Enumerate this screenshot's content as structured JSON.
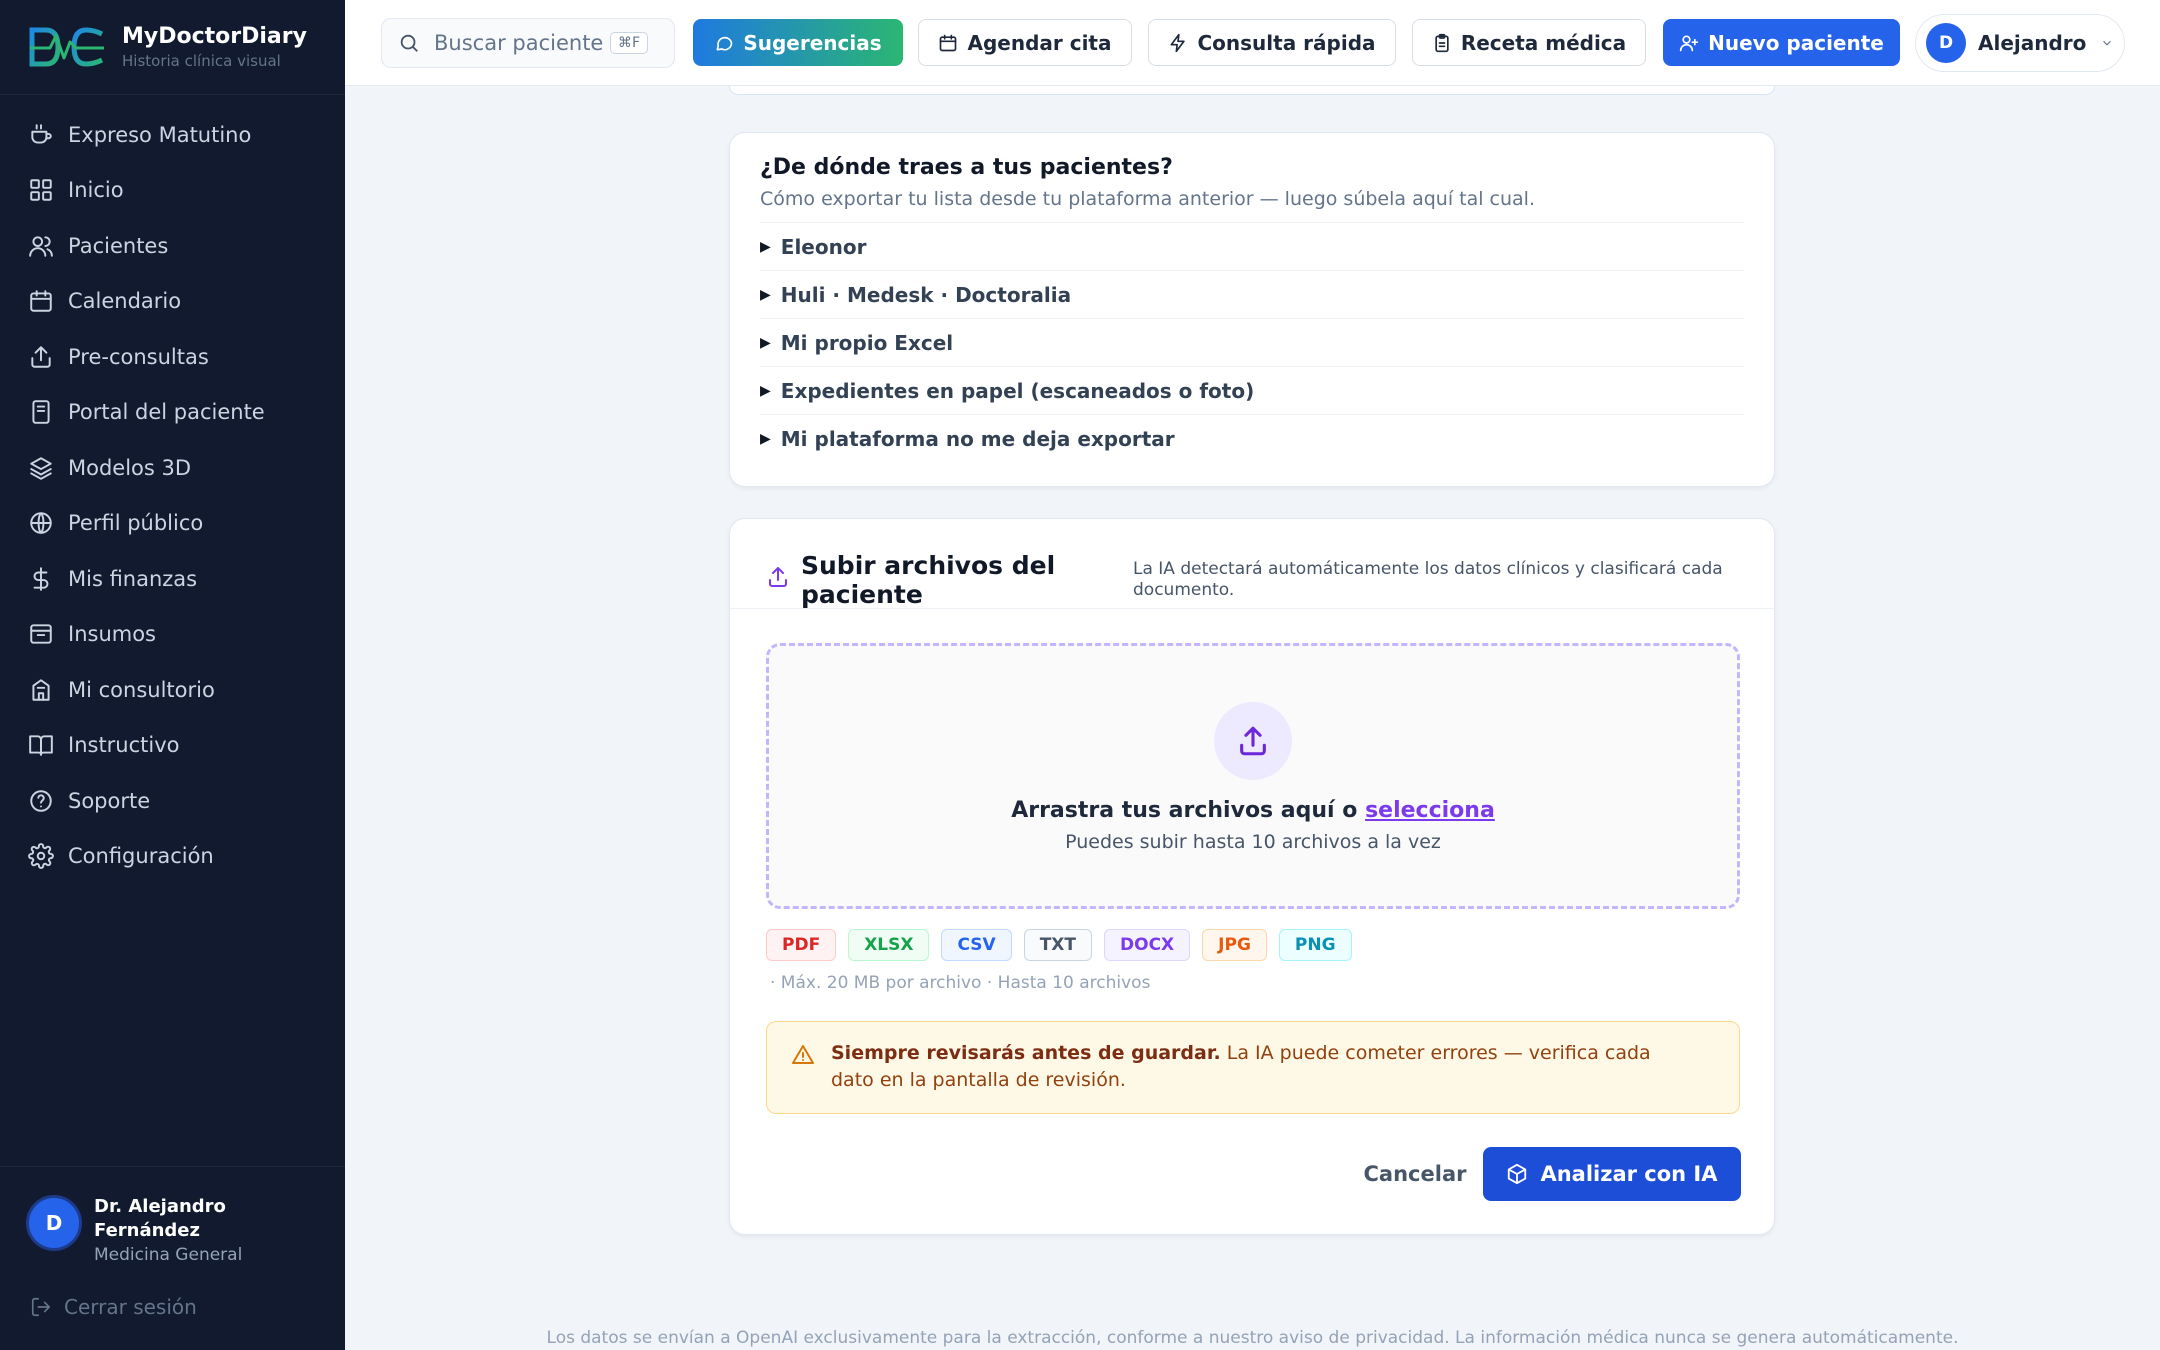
{
  "brand": {
    "name": "MyDoctorDiary",
    "tagline": "Historia clínica visual"
  },
  "sidebar": {
    "items": [
      {
        "label": "Expreso Matutino",
        "icon": "coffee-icon"
      },
      {
        "label": "Inicio",
        "icon": "grid-icon"
      },
      {
        "label": "Pacientes",
        "icon": "users-icon"
      },
      {
        "label": "Calendario",
        "icon": "calendar-icon"
      },
      {
        "label": "Pre-consultas",
        "icon": "share-icon"
      },
      {
        "label": "Portal del paciente",
        "icon": "tablet-icon"
      },
      {
        "label": "Modelos 3D",
        "icon": "layers-icon"
      },
      {
        "label": "Perfil público",
        "icon": "globe-icon"
      },
      {
        "label": "Mis finanzas",
        "icon": "dollar-icon"
      },
      {
        "label": "Insumos",
        "icon": "archive-icon"
      },
      {
        "label": "Mi consultorio",
        "icon": "building-icon"
      },
      {
        "label": "Instructivo",
        "icon": "book-icon"
      },
      {
        "label": "Soporte",
        "icon": "help-circle-icon"
      },
      {
        "label": "Configuración",
        "icon": "gear-icon"
      }
    ],
    "user": {
      "initial": "D",
      "name": "Dr. Alejandro Fernández",
      "role": "Medicina General"
    },
    "logout_label": "Cerrar sesión"
  },
  "topbar": {
    "search_placeholder": "Buscar paciente",
    "search_shortcut": "⌘F",
    "buttons": {
      "suggestions": "Sugerencias",
      "schedule": "Agendar cita",
      "quick": "Consulta rápida",
      "prescription": "Receta médica",
      "new_patient": "Nuevo paciente"
    },
    "user": {
      "initial": "D",
      "name": "Alejandro"
    }
  },
  "import_sources": {
    "title": "¿De dónde traes a tus pacientes?",
    "description": "Cómo exportar tu lista desde tu plataforma anterior — luego súbela aquí tal cual.",
    "items": [
      "Eleonor",
      "Huli · Medesk · Doctoralia",
      "Mi propio Excel",
      "Expedientes en papel (escaneados o foto)",
      "Mi plataforma no me deja exportar"
    ]
  },
  "upload": {
    "title": "Subir archivos del paciente",
    "note": "La IA detectará automáticamente los datos clínicos y clasificará cada documento.",
    "drop_text": "Arrastra tus archivos aquí o",
    "drop_link": "selecciona",
    "drop_sub": "Puedes subir hasta 10 archivos a la vez",
    "file_types": [
      {
        "label": "PDF",
        "color": "#dc2626",
        "bg": "#fef2f2",
        "border": "#fecaca"
      },
      {
        "label": "XLSX",
        "color": "#16a34a",
        "bg": "#f0fdf4",
        "border": "#bbf7d0"
      },
      {
        "label": "CSV",
        "color": "#2563eb",
        "bg": "#eff6ff",
        "border": "#bfdbfe"
      },
      {
        "label": "TXT",
        "color": "#475569",
        "bg": "#f8fafc",
        "border": "#cbd5e1"
      },
      {
        "label": "DOCX",
        "color": "#7c3aed",
        "bg": "#f5f3ff",
        "border": "#ddd6fe"
      },
      {
        "label": "JPG",
        "color": "#ea580c",
        "bg": "#fff7ed",
        "border": "#fed7aa"
      },
      {
        "label": "PNG",
        "color": "#0891b2",
        "bg": "#ecfeff",
        "border": "#a5f3fc"
      }
    ],
    "limits": "· Máx. 20 MB por archivo · Hasta 10 archivos",
    "warning_bold": "Siempre revisarás antes de guardar.",
    "warning_text": "La IA puede cometer errores — verifica cada dato en la pantalla de revisión.",
    "cancel_label": "Cancelar",
    "analyze_label": "Analizar con IA"
  },
  "footer_text": "Los datos se envían a OpenAI exclusivamente para la extracción, conforme a nuestro aviso de privacidad. La información médica nunca se genera automáticamente."
}
